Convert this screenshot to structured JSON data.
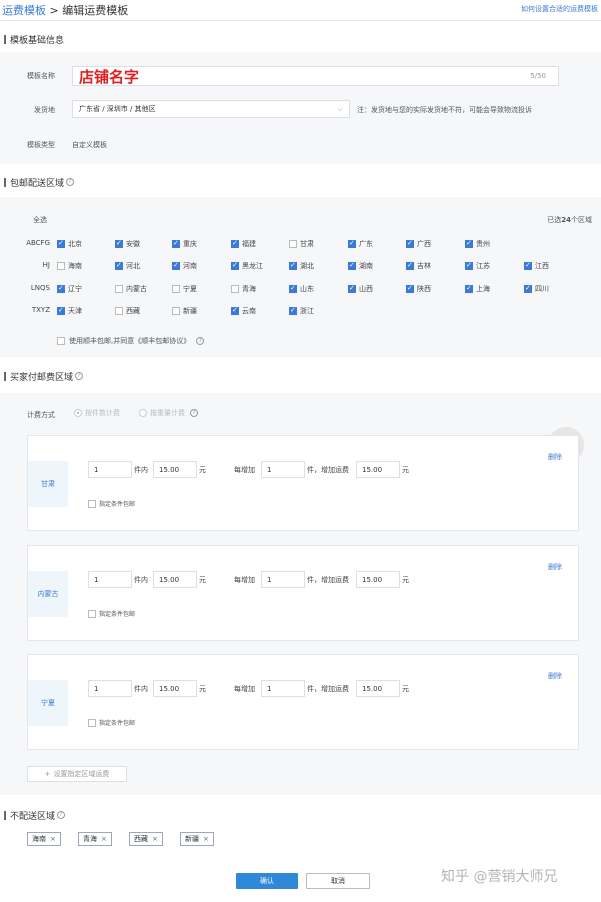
{
  "breadcrumb": {
    "parent": "运费模板",
    "sep": ">",
    "current": "编辑运费模板"
  },
  "help_link": "如何设置合适的运费模板",
  "basic": {
    "section_title": "模板基础信息",
    "name_label": "模板名称",
    "name_value": "店铺名字",
    "name_count": "5/50",
    "ship_label": "发货地",
    "ship_value": "广东省 / 深圳市 / 其他区",
    "ship_note": "注：发货地与您的实际发货地不符，可能会导致物流投诉",
    "type_label": "模板类型",
    "type_value": "自定义模板"
  },
  "free_area": {
    "section_title": "包邮配送区域",
    "select_all": "全选",
    "selected_prefix": "已选",
    "selected_count": "24",
    "selected_suffix": "个区域",
    "groups": [
      "ABCFG",
      "HJ",
      "LNQS",
      "TXYZ"
    ],
    "rows": [
      [
        {
          "n": "北京",
          "c": true
        },
        {
          "n": "安徽",
          "c": true
        },
        {
          "n": "重庆",
          "c": true
        },
        {
          "n": "福建",
          "c": true
        },
        {
          "n": "甘肃",
          "c": false
        },
        {
          "n": "广东",
          "c": true
        },
        {
          "n": "广西",
          "c": true
        },
        {
          "n": "贵州",
          "c": true
        }
      ],
      [
        {
          "n": "海南",
          "c": false
        },
        {
          "n": "河北",
          "c": true
        },
        {
          "n": "河南",
          "c": true
        },
        {
          "n": "黑龙江",
          "c": true
        },
        {
          "n": "湖北",
          "c": true
        },
        {
          "n": "湖南",
          "c": true
        },
        {
          "n": "吉林",
          "c": true
        },
        {
          "n": "江苏",
          "c": true
        },
        {
          "n": "江西",
          "c": true
        }
      ],
      [
        {
          "n": "辽宁",
          "c": true
        },
        {
          "n": "内蒙古",
          "c": false
        },
        {
          "n": "宁夏",
          "c": false
        },
        {
          "n": "青海",
          "c": false
        },
        {
          "n": "山东",
          "c": true
        },
        {
          "n": "山西",
          "c": true
        },
        {
          "n": "陕西",
          "c": true
        },
        {
          "n": "上海",
          "c": true
        },
        {
          "n": "四川",
          "c": true
        }
      ],
      [
        {
          "n": "天津",
          "c": true
        },
        {
          "n": "西藏",
          "c": false
        },
        {
          "n": "新疆",
          "c": false
        },
        {
          "n": "云南",
          "c": true
        },
        {
          "n": "浙江",
          "c": true
        }
      ]
    ],
    "sf_agree": "使用顺丰包邮,并同意《顺丰包邮协议》"
  },
  "paid_area": {
    "section_title": "买家付邮费区域",
    "calc_label": "计费方式",
    "calc_by_count": "按件数计费",
    "calc_by_weight": "按重量计费",
    "cards": [
      {
        "region": "甘肃",
        "first_qty": "1",
        "first_fee": "15.00",
        "add_qty": "1",
        "add_fee": "15.00"
      },
      {
        "region": "内蒙古",
        "first_qty": "1",
        "first_fee": "15.00",
        "add_qty": "1",
        "add_fee": "15.00"
      },
      {
        "region": "宁夏",
        "first_qty": "1",
        "first_fee": "15.00",
        "add_qty": "1",
        "add_fee": "15.00"
      }
    ],
    "txt_within": "件内",
    "txt_yuan": "元",
    "txt_each_add": "每增加",
    "txt_add_fee": "件，增加运费",
    "txt_delete": "删除",
    "txt_cond_free": "指定条件包邮",
    "add_region_btn": "设置指定区域运费"
  },
  "no_ship": {
    "section_title": "不配送区域",
    "tags": [
      "海南",
      "青海",
      "西藏",
      "新疆"
    ]
  },
  "footer": {
    "confirm": "确认",
    "cancel": "取消"
  },
  "watermark": "知乎 @营销大师兄",
  "colors": {
    "accent": "#2f88d8",
    "link": "#3a7bd5",
    "shop_name": "#e02020",
    "panel_bg": "#f6f7f9"
  }
}
